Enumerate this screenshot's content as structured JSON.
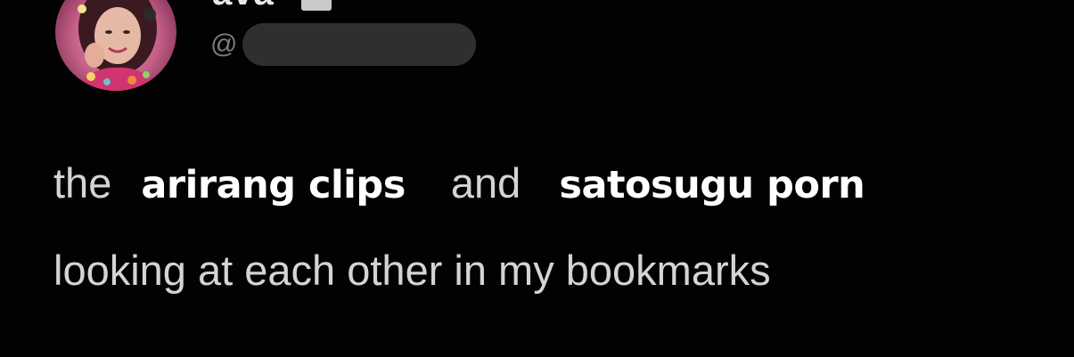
{
  "profile": {
    "display_name": "ava",
    "handle_prefix": "@",
    "avatar_icon": "profile-photo"
  },
  "tweet": {
    "word_the": "the",
    "caption_1": "arirang clips",
    "word_and": "and",
    "caption_2": "satosugu porn",
    "line_2": "looking at each other in my bookmarks"
  },
  "colors": {
    "background": "#020202",
    "tweet_text": "#d4d4d4",
    "caption_text": "#ffffff",
    "handle_text": "#7c7c7c",
    "redaction": "#2f2f31"
  }
}
